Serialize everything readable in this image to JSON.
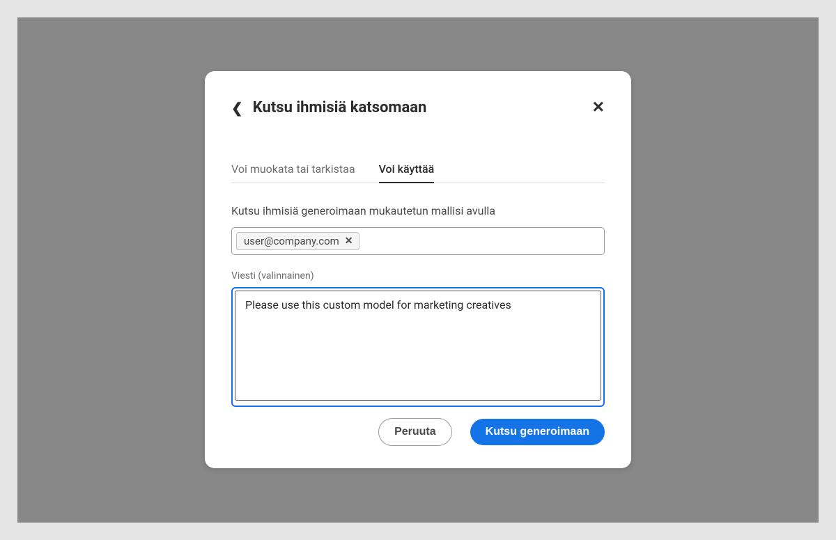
{
  "modal": {
    "title": "Kutsu ihmisiä katsomaan",
    "tabs": [
      {
        "label": "Voi muokata tai tarkistaa",
        "active": false
      },
      {
        "label": "Voi käyttää",
        "active": true
      }
    ],
    "invite_label": "Kutsu ihmisiä generoimaan mukautetun mallisi avulla",
    "email_chip": "user@company.com",
    "message_label": "Viesti (valinnainen)",
    "message_value": "Please use this custom model for marketing creatives",
    "cancel_label": "Peruuta",
    "submit_label": "Kutsu generoimaan"
  }
}
